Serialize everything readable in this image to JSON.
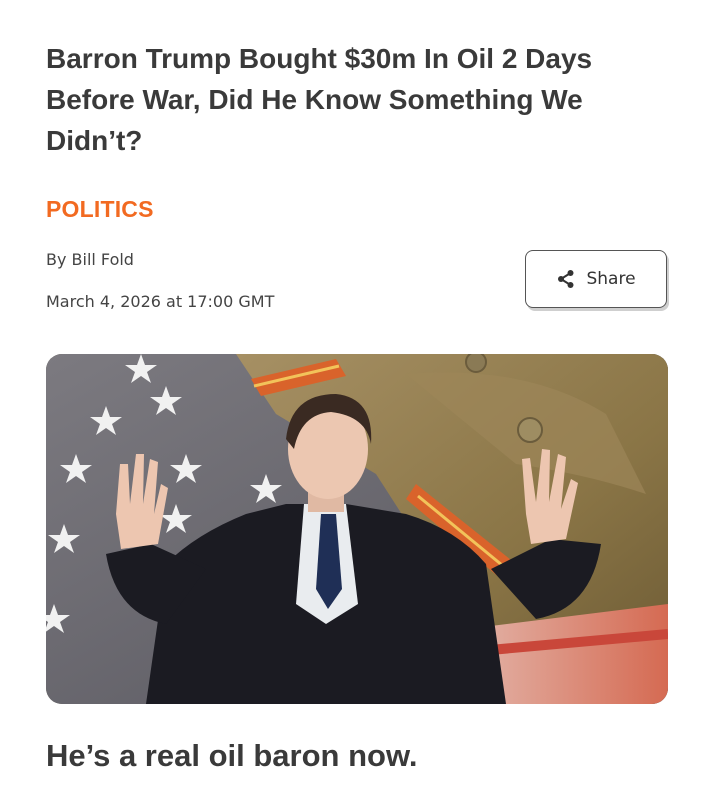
{
  "article": {
    "headline": "Barron Trump Bought $30m In Oil 2 Days Before War, Did He Know Something We Didn’t?",
    "category": "POLITICS",
    "byline": "By Bill Fold",
    "date": "March 4, 2026 at 17:00 GMT",
    "subheadline": "He’s a real oil baron now."
  },
  "share": {
    "label": "Share",
    "icon": "share-icon"
  },
  "colors": {
    "accent": "#f26a21",
    "text": "#3a3a3a"
  }
}
